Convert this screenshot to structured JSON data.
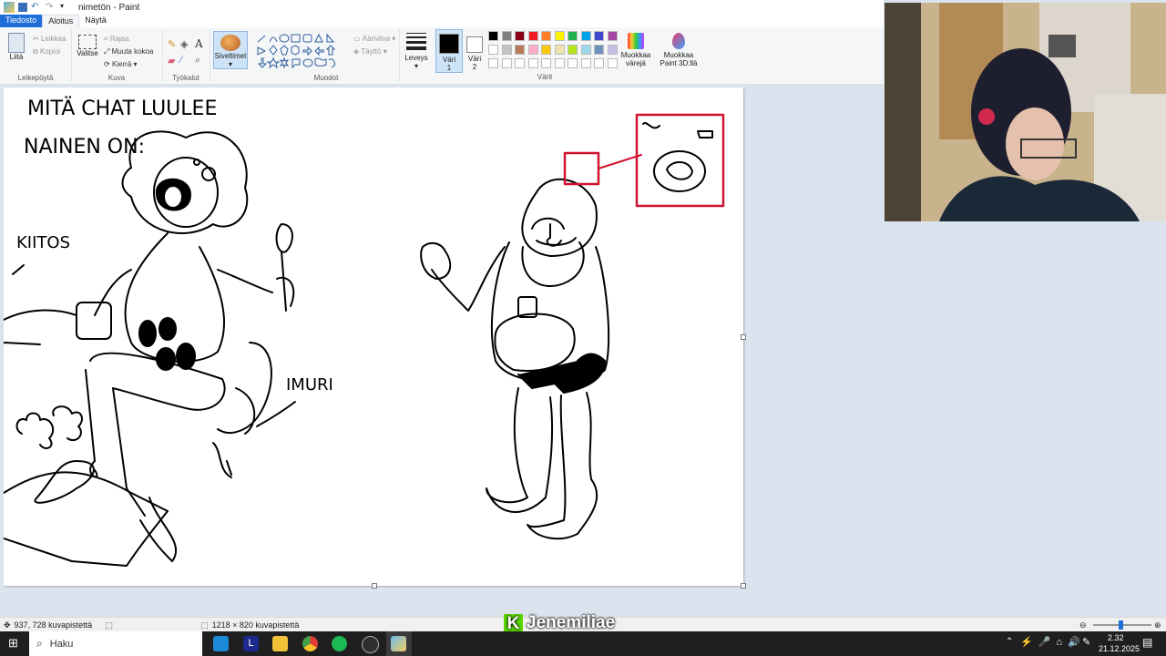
{
  "window": {
    "title": "nimetön - Paint"
  },
  "tabs": [
    {
      "label": "Tiedosto"
    },
    {
      "label": "Aloitus"
    },
    {
      "label": "Näytä"
    }
  ],
  "ribbon": {
    "clipboard": {
      "paste": "Liitä",
      "cut": "Leikkaa",
      "copy": "Kopioi",
      "label": "Leikepöytä"
    },
    "image": {
      "select": "Valitse",
      "crop": "Rajaa",
      "resize": "Muuta kokoa",
      "rotate": "Kierrä",
      "label": "Kuva"
    },
    "tools": {
      "label": "Työkalut",
      "text_glyph": "A"
    },
    "brushes": {
      "label": "Siveltimet"
    },
    "shapes": {
      "outline": "Ääriviiva",
      "fill": "Täyttö",
      "label": "Muodot"
    },
    "size": {
      "label": "Leveys"
    },
    "color1": {
      "label": "Väri",
      "num": "1"
    },
    "color2": {
      "label": "Väri",
      "num": "2"
    },
    "colors": {
      "label": "Värit"
    },
    "edit_colors": {
      "line1": "Muokkaa",
      "line2": "värejä"
    },
    "paint3d": {
      "line1": "Muokkaa",
      "line2": "Paint 3D:llä"
    }
  },
  "palette": {
    "row1": [
      "#000000",
      "#7f7f7f",
      "#880015",
      "#ed1c24",
      "#ff7f27",
      "#fff200",
      "#22b14c",
      "#00a2e8",
      "#3f48cc",
      "#a349a4"
    ],
    "row2": [
      "#ffffff",
      "#c3c3c3",
      "#b97a57",
      "#ffaec9",
      "#ffc90e",
      "#efe4b0",
      "#b5e61d",
      "#99d9ea",
      "#7092be",
      "#c8bfe7"
    ],
    "row3": [
      "#ffffff",
      "#ffffff",
      "#ffffff",
      "#ffffff",
      "#ffffff",
      "#ffffff",
      "#ffffff",
      "#ffffff",
      "#ffffff",
      "#ffffff"
    ]
  },
  "drawing": {
    "title_line1": "MITÄ CHAT LUULEE",
    "title_line2": "NAINEN ON:",
    "kiitos": "KIITOS",
    "imuri": "IMURI"
  },
  "status": {
    "cursor": "937, 728 kuvapistettä",
    "dimensions": "1218 × 820 kuvapistettä"
  },
  "taskbar": {
    "search_placeholder": "Haku",
    "time": "2.32",
    "date": "21.12.2025"
  },
  "overlay": {
    "name": "Jenemiliae",
    "logo_letter": "K"
  },
  "accent": "#1e6fd9"
}
